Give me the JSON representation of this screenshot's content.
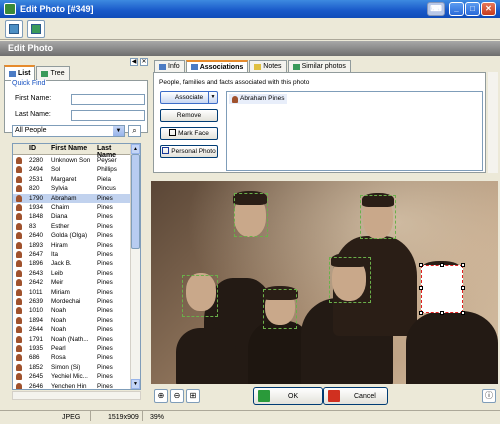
{
  "window": {
    "title": "Edit Photo [#349]"
  },
  "header": {
    "title": "Edit Photo"
  },
  "left": {
    "tabs": [
      {
        "label": "List"
      },
      {
        "label": "Tree"
      }
    ],
    "quick_find": {
      "legend": "Quick Find",
      "first_name_label": "First Name:",
      "last_name_label": "Last Name:",
      "first_name_value": "",
      "last_name_value": ""
    },
    "filter": {
      "selected": "All People"
    },
    "columns": [
      "ID",
      "First Name",
      "Last Name"
    ],
    "rows": [
      {
        "id": "2280",
        "first": "Unknown Son",
        "last": "Peyser"
      },
      {
        "id": "2494",
        "first": "Sol",
        "last": "Phillips"
      },
      {
        "id": "2531",
        "first": "Margaret",
        "last": "Piela"
      },
      {
        "id": "820",
        "first": "Sylvia",
        "last": "Pincus"
      },
      {
        "id": "1790",
        "first": "Abraham",
        "last": "Pines"
      },
      {
        "id": "1934",
        "first": "Chaim",
        "last": "Pines"
      },
      {
        "id": "1848",
        "first": "Diana",
        "last": "Pines"
      },
      {
        "id": "83",
        "first": "Esther",
        "last": "Pines"
      },
      {
        "id": "2640",
        "first": "Golda (Olga)",
        "last": "Pines"
      },
      {
        "id": "1893",
        "first": "Hiram",
        "last": "Pines"
      },
      {
        "id": "2647",
        "first": "Ita",
        "last": "Pines"
      },
      {
        "id": "1896",
        "first": "Jack B.",
        "last": "Pines"
      },
      {
        "id": "2643",
        "first": "Leib",
        "last": "Pines"
      },
      {
        "id": "2642",
        "first": "Meir",
        "last": "Pines"
      },
      {
        "id": "1011",
        "first": "Miriam",
        "last": "Pines"
      },
      {
        "id": "2639",
        "first": "Mordechai",
        "last": "Pines"
      },
      {
        "id": "1010",
        "first": "Noah",
        "last": "Pines"
      },
      {
        "id": "1894",
        "first": "Noah",
        "last": "Pines"
      },
      {
        "id": "2644",
        "first": "Noah",
        "last": "Pines"
      },
      {
        "id": "1791",
        "first": "Noah (Nath...",
        "last": "Pines"
      },
      {
        "id": "1935",
        "first": "Pearl",
        "last": "Pines"
      },
      {
        "id": "686",
        "first": "Rosa",
        "last": "Pines"
      },
      {
        "id": "1852",
        "first": "Simon (Si)",
        "last": "Pines"
      },
      {
        "id": "2645",
        "first": "Yechiel Mic...",
        "last": "Pines"
      },
      {
        "id": "2646",
        "first": "Yenchen Hin",
        "last": "Pines"
      }
    ]
  },
  "right": {
    "tabs": [
      {
        "label": "Info"
      },
      {
        "label": "Associations"
      },
      {
        "label": "Notes"
      },
      {
        "label": "Similar photos"
      }
    ],
    "assoc_label": "People, families and facts associated with this photo",
    "buttons": {
      "associate": "Associate",
      "remove": "Remove",
      "mark_face": "Mark Face",
      "personal_photo": "Personal Photo"
    },
    "associated": [
      {
        "name": "Abraham Pines"
      }
    ]
  },
  "footer": {
    "ok": "OK",
    "cancel": "Cancel"
  },
  "status": {
    "format": "JPEG",
    "dimensions": "1519x909",
    "zoom": "39%"
  },
  "colors": {
    "selected_face": "#e02020",
    "face_box": "#6ab04a",
    "title_bar": "#1858c8"
  }
}
